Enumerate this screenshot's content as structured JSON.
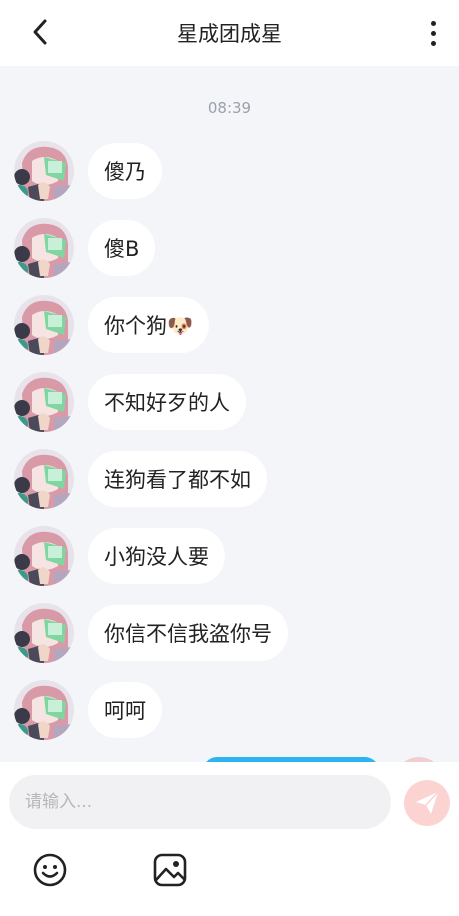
{
  "header": {
    "title": "星成团成星"
  },
  "chat": {
    "timestamp": "08:39",
    "messages": [
      {
        "text": "傻乃"
      },
      {
        "text": "傻B"
      },
      {
        "text": "你个狗🐶"
      },
      {
        "text": "不知好歹的人"
      },
      {
        "text": "连狗看了都不如"
      },
      {
        "text": "小狗没人要"
      },
      {
        "text": "你信不信我盗你号"
      },
      {
        "text": "呵呵"
      }
    ]
  },
  "composer": {
    "placeholder": "请输入...",
    "value": ""
  },
  "icons": {
    "back": "chevron-left-icon",
    "more": "more-vertical-icon",
    "send": "send-plane-icon",
    "emoji": "smiley-icon",
    "image": "image-icon"
  },
  "colors": {
    "accent": "#2bb4f0",
    "send_disabled": "#fbd4d2",
    "background": "#f4f5f9"
  }
}
